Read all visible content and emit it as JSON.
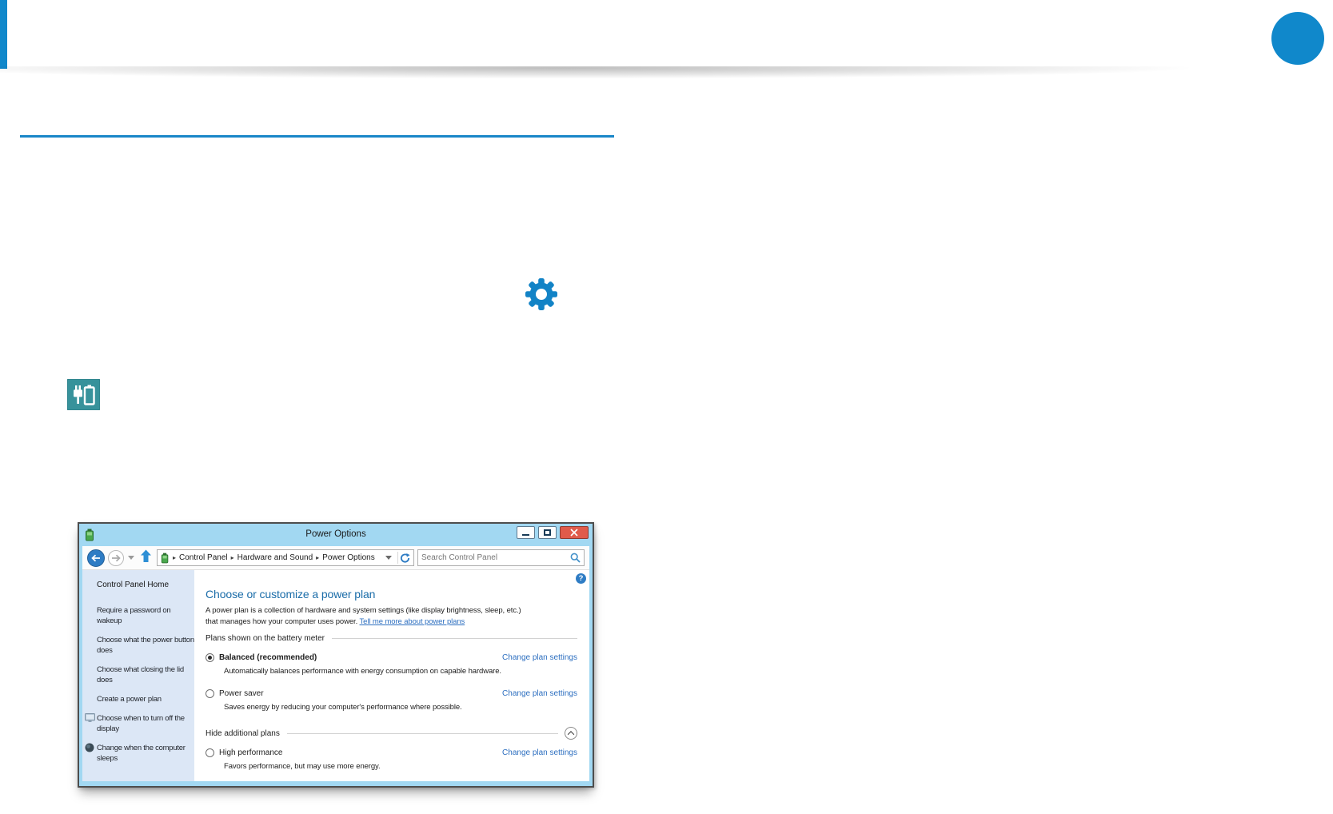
{
  "colors": {
    "accent": "#1088cb",
    "window_frame": "#a2d8f2",
    "sidebar_bg": "#dce7f6",
    "heading": "#1a6ca8",
    "link": "#2d6fc0",
    "teal_icon_bg": "#37929b",
    "close_button": "#e05b4b"
  },
  "window": {
    "title": "Power Options",
    "navbar": {
      "crumb_separator": "▸",
      "breadcrumb": [
        "Control Panel",
        "Hardware and Sound",
        "Power Options"
      ],
      "search_placeholder": "Search Control Panel"
    },
    "sidebar": {
      "home_label": "Control Panel Home",
      "items": [
        "Require a password on wakeup",
        "Choose what the power button does",
        "Choose what closing the lid does",
        "Create a power plan",
        "Choose when to turn off the display",
        "Change when the computer sleeps"
      ]
    },
    "content": {
      "help_glyph": "?",
      "heading": "Choose or customize a power plan",
      "intro_line1": "A power plan is a collection of hardware and system settings (like display brightness, sleep, etc.)",
      "intro_line2": "that manages how your computer uses power.",
      "intro_link": "Tell me more about power plans",
      "section_label": "Plans shown on the battery meter",
      "plans": [
        {
          "name": "Balanced (recommended)",
          "selected": true,
          "desc": "Automatically balances performance with energy consumption on capable hardware.",
          "link": "Change plan settings"
        },
        {
          "name": "Power saver",
          "selected": false,
          "desc": "Saves energy by reducing your computer's performance where possible.",
          "link": "Change plan settings"
        }
      ],
      "hide_label": "Hide additional plans",
      "additional_plans": [
        {
          "name": "High performance",
          "selected": false,
          "desc": "Favors performance, but may use more energy.",
          "link": "Change plan settings"
        }
      ]
    }
  }
}
